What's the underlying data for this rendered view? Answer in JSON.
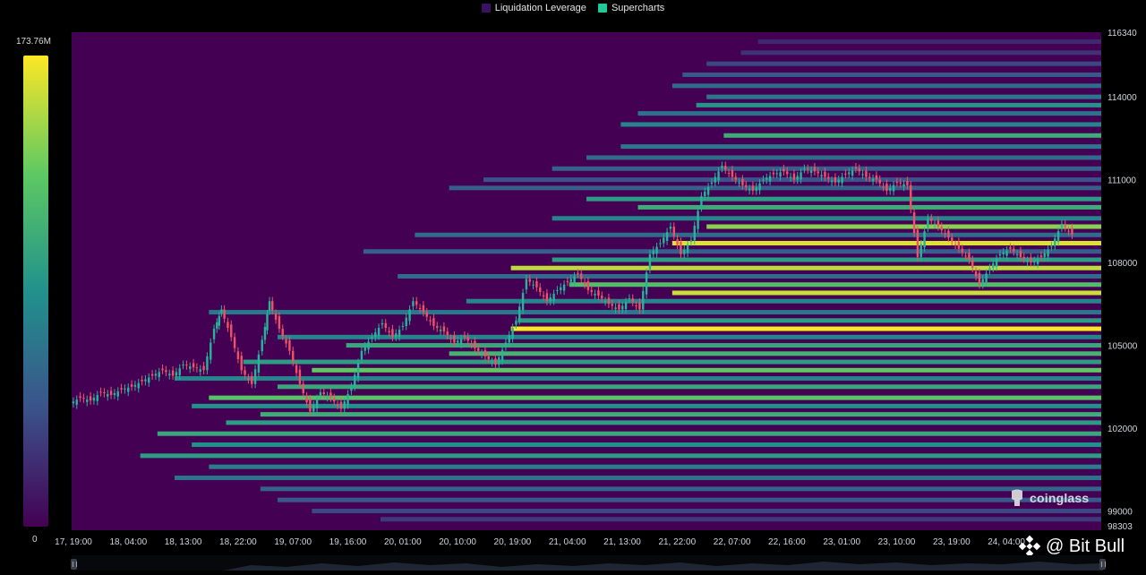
{
  "legend": {
    "items": [
      {
        "label": "Liquidation Leverage",
        "color": "#3b1164"
      },
      {
        "label": "Supercharts",
        "color": "#20c997"
      }
    ]
  },
  "colorbar": {
    "max_label": "173.76M",
    "min_label": "0",
    "colors": [
      "#440154",
      "#3b528b",
      "#21918c",
      "#5ec962",
      "#fde725"
    ]
  },
  "watermark": {
    "brand": "coinglass",
    "overlay": "@ Bit Bull"
  },
  "chart_data": {
    "type": "heatmap",
    "title": "",
    "xlabel": "",
    "ylabel": "",
    "x_ticks": [
      "17, 19:00",
      "18, 04:00",
      "18, 13:00",
      "18, 22:00",
      "19, 07:00",
      "19, 16:00",
      "20, 01:00",
      "20, 10:00",
      "20, 19:00",
      "21, 04:00",
      "21, 13:00",
      "21, 22:00",
      "22, 07:00",
      "22, 16:00",
      "23, 01:00",
      "23, 10:00",
      "23, 19:00",
      "24, 04:00"
    ],
    "y_ticks": [
      "116340",
      "114000",
      "111000",
      "108000",
      "105000",
      "102000",
      "99000",
      "98303"
    ],
    "y_tick_values": [
      116340,
      114000,
      111000,
      108000,
      105000,
      102000,
      99000,
      98303
    ],
    "ylim": [
      98303,
      116340
    ],
    "colorscale_range": [
      0,
      173.76
    ],
    "colorscale_unit": "M",
    "price_series": [
      [
        0,
        102900
      ],
      [
        3,
        103100
      ],
      [
        6,
        103000
      ],
      [
        9,
        103300
      ],
      [
        12,
        103200
      ],
      [
        15,
        103400
      ],
      [
        18,
        103500
      ],
      [
        21,
        103700
      ],
      [
        24,
        103900
      ],
      [
        27,
        104100
      ],
      [
        30,
        103900
      ],
      [
        33,
        104300
      ],
      [
        36,
        104200
      ],
      [
        39,
        104100
      ],
      [
        42,
        105600
      ],
      [
        44,
        106300
      ],
      [
        47,
        105300
      ],
      [
        50,
        104100
      ],
      [
        53,
        103600
      ],
      [
        56,
        105200
      ],
      [
        58,
        106600
      ],
      [
        61,
        105600
      ],
      [
        64,
        104800
      ],
      [
        67,
        103600
      ],
      [
        70,
        102600
      ],
      [
        73,
        103300
      ],
      [
        76,
        103100
      ],
      [
        79,
        102700
      ],
      [
        82,
        103500
      ],
      [
        85,
        104800
      ],
      [
        88,
        105300
      ],
      [
        91,
        105800
      ],
      [
        94,
        105300
      ],
      [
        97,
        105700
      ],
      [
        100,
        106600
      ],
      [
        103,
        106200
      ],
      [
        106,
        105700
      ],
      [
        109,
        105500
      ],
      [
        112,
        105100
      ],
      [
        115,
        105300
      ],
      [
        118,
        104900
      ],
      [
        121,
        104600
      ],
      [
        124,
        104300
      ],
      [
        127,
        105100
      ],
      [
        130,
        105900
      ],
      [
        133,
        107400
      ],
      [
        136,
        107100
      ],
      [
        139,
        106600
      ],
      [
        142,
        107000
      ],
      [
        145,
        107300
      ],
      [
        148,
        107600
      ],
      [
        151,
        107000
      ],
      [
        154,
        106800
      ],
      [
        157,
        106500
      ],
      [
        160,
        106300
      ],
      [
        163,
        106700
      ],
      [
        166,
        106300
      ],
      [
        169,
        108300
      ],
      [
        172,
        108700
      ],
      [
        175,
        109300
      ],
      [
        178,
        108300
      ],
      [
        181,
        108800
      ],
      [
        184,
        110400
      ],
      [
        187,
        110900
      ],
      [
        190,
        111500
      ],
      [
        193,
        111100
      ],
      [
        196,
        110800
      ],
      [
        199,
        110600
      ],
      [
        202,
        111000
      ],
      [
        205,
        111200
      ],
      [
        208,
        111300
      ],
      [
        211,
        111000
      ],
      [
        214,
        111400
      ],
      [
        217,
        111300
      ],
      [
        220,
        111100
      ],
      [
        223,
        110900
      ],
      [
        226,
        111200
      ],
      [
        229,
        111400
      ],
      [
        232,
        111100
      ],
      [
        235,
        111000
      ],
      [
        238,
        110600
      ],
      [
        241,
        110900
      ],
      [
        244,
        110800
      ],
      [
        247,
        108200
      ],
      [
        250,
        109600
      ],
      [
        253,
        109300
      ],
      [
        256,
        108900
      ],
      [
        259,
        108500
      ],
      [
        262,
        108100
      ],
      [
        265,
        107200
      ],
      [
        268,
        107800
      ],
      [
        271,
        108300
      ],
      [
        274,
        108500
      ],
      [
        277,
        108200
      ],
      [
        280,
        108000
      ],
      [
        283,
        108200
      ],
      [
        286,
        108600
      ],
      [
        289,
        109400
      ],
      [
        292,
        109000
      ]
    ],
    "liquidation_bands": [
      {
        "price": 116000,
        "start": 200,
        "level": 0.12
      },
      {
        "price": 115600,
        "start": 195,
        "level": 0.15
      },
      {
        "price": 115200,
        "start": 185,
        "level": 0.22
      },
      {
        "price": 114800,
        "start": 178,
        "level": 0.28
      },
      {
        "price": 114400,
        "start": 175,
        "level": 0.35
      },
      {
        "price": 114000,
        "start": 185,
        "level": 0.4
      },
      {
        "price": 113700,
        "start": 182,
        "level": 0.52
      },
      {
        "price": 113400,
        "start": 165,
        "level": 0.38
      },
      {
        "price": 113000,
        "start": 160,
        "level": 0.45
      },
      {
        "price": 112600,
        "start": 190,
        "level": 0.62
      },
      {
        "price": 112200,
        "start": 160,
        "level": 0.4
      },
      {
        "price": 111800,
        "start": 150,
        "level": 0.35
      },
      {
        "price": 111400,
        "start": 140,
        "level": 0.3
      },
      {
        "price": 111000,
        "start": 120,
        "level": 0.25
      },
      {
        "price": 110700,
        "start": 110,
        "level": 0.3
      },
      {
        "price": 110300,
        "start": 150,
        "level": 0.55
      },
      {
        "price": 110000,
        "start": 165,
        "level": 0.62
      },
      {
        "price": 109600,
        "start": 140,
        "level": 0.45
      },
      {
        "price": 109300,
        "start": 185,
        "level": 0.82
      },
      {
        "price": 109000,
        "start": 100,
        "level": 0.35
      },
      {
        "price": 108700,
        "start": 175,
        "level": 0.95
      },
      {
        "price": 108400,
        "start": 85,
        "level": 0.3
      },
      {
        "price": 108100,
        "start": 140,
        "level": 0.55
      },
      {
        "price": 107800,
        "start": 128,
        "level": 0.9
      },
      {
        "price": 107500,
        "start": 95,
        "level": 0.35
      },
      {
        "price": 107200,
        "start": 145,
        "level": 0.7
      },
      {
        "price": 106900,
        "start": 175,
        "level": 0.92
      },
      {
        "price": 106600,
        "start": 115,
        "level": 0.45
      },
      {
        "price": 106200,
        "start": 40,
        "level": 0.4
      },
      {
        "price": 105900,
        "start": 130,
        "level": 0.55
      },
      {
        "price": 105600,
        "start": 128,
        "level": 1.0
      },
      {
        "price": 105300,
        "start": 60,
        "level": 0.45
      },
      {
        "price": 105000,
        "start": 80,
        "level": 0.6
      },
      {
        "price": 104700,
        "start": 110,
        "level": 0.65
      },
      {
        "price": 104400,
        "start": 50,
        "level": 0.55
      },
      {
        "price": 104100,
        "start": 70,
        "level": 0.75
      },
      {
        "price": 103800,
        "start": 30,
        "level": 0.45
      },
      {
        "price": 103500,
        "start": 60,
        "level": 0.6
      },
      {
        "price": 103100,
        "start": 40,
        "level": 0.72
      },
      {
        "price": 102800,
        "start": 35,
        "level": 0.5
      },
      {
        "price": 102500,
        "start": 55,
        "level": 0.62
      },
      {
        "price": 102200,
        "start": 45,
        "level": 0.55
      },
      {
        "price": 101800,
        "start": 25,
        "level": 0.6
      },
      {
        "price": 101400,
        "start": 35,
        "level": 0.5
      },
      {
        "price": 101000,
        "start": 20,
        "level": 0.55
      },
      {
        "price": 100600,
        "start": 40,
        "level": 0.42
      },
      {
        "price": 100200,
        "start": 30,
        "level": 0.38
      },
      {
        "price": 99800,
        "start": 55,
        "level": 0.32
      },
      {
        "price": 99400,
        "start": 60,
        "level": 0.28
      },
      {
        "price": 99000,
        "start": 70,
        "level": 0.22
      },
      {
        "price": 98700,
        "start": 90,
        "level": 0.18
      }
    ]
  }
}
